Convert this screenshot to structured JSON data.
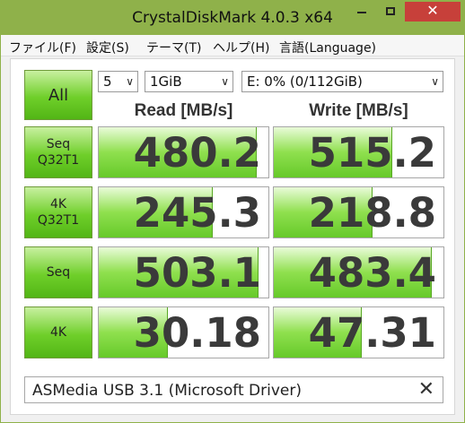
{
  "window": {
    "title": "CrystalDiskMark 4.0.3 x64",
    "buttons": {
      "minimize": "minimize-icon",
      "maximize": "maximize-icon",
      "close": "close-icon",
      "close_glyph": "✕"
    }
  },
  "menu": {
    "items": [
      "ファイル(F)",
      "設定(S)",
      "テーマ(T)",
      "ヘルプ(H)",
      "言語(Language)"
    ]
  },
  "controls": {
    "all_button": "All",
    "count": "5",
    "size": "1GiB",
    "drive": "E: 0% (0/112GiB)",
    "dropdown_arrow": "∨"
  },
  "headers": {
    "read": "Read [MB/s]",
    "write": "Write [MB/s]"
  },
  "rows": [
    {
      "label_line1": "Seq",
      "label_line2": "Q32T1",
      "read": "480.2",
      "write": "515.2",
      "read_level": 0.93,
      "write_level": 0.7
    },
    {
      "label_line1": "4K",
      "label_line2": "Q32T1",
      "read": "245.3",
      "write": "218.8",
      "read_level": 0.67,
      "write_level": 0.58
    },
    {
      "label_line1": "Seq",
      "label_line2": "",
      "read": "503.1",
      "write": "483.4",
      "read_level": 0.94,
      "write_level": 0.93
    },
    {
      "label_line1": "4K",
      "label_line2": "",
      "read": "30.18",
      "write": "47.31",
      "read_level": 0.41,
      "write_level": 0.52
    }
  ],
  "comment": {
    "text": "ASMedia USB 3.1 (Microsoft Driver)",
    "close_glyph": "✕"
  },
  "colors": {
    "accent": "#8fb14a",
    "bar": "#7ad63c",
    "close": "#c7403a"
  }
}
